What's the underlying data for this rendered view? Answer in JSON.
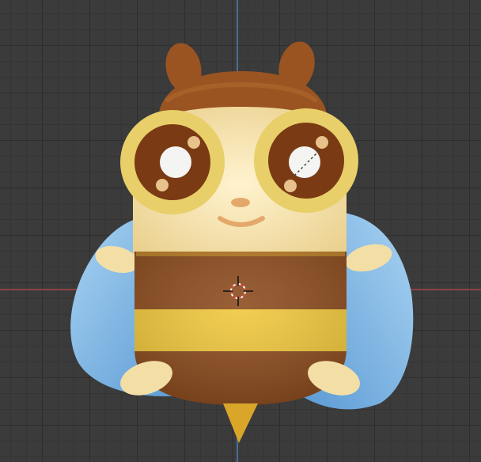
{
  "viewport": {
    "label": "3D Viewport",
    "grid_visible": true,
    "axis_x_color": "#b94a4a",
    "axis_y_color": "#4a7db9"
  },
  "scene": {
    "object": "bee-model",
    "colors": {
      "cream": "#f3dfa6",
      "cream_shadow": "#e2c98a",
      "brown": "#8b4a1c",
      "brown_dark": "#6e3612",
      "yellow": "#f0c73a",
      "eye_ring": "#e8cf6a",
      "wing": "#8fc3ea",
      "stinger": "#d9a62a"
    }
  },
  "cursor_3d": {
    "name": "3d-cursor"
  }
}
